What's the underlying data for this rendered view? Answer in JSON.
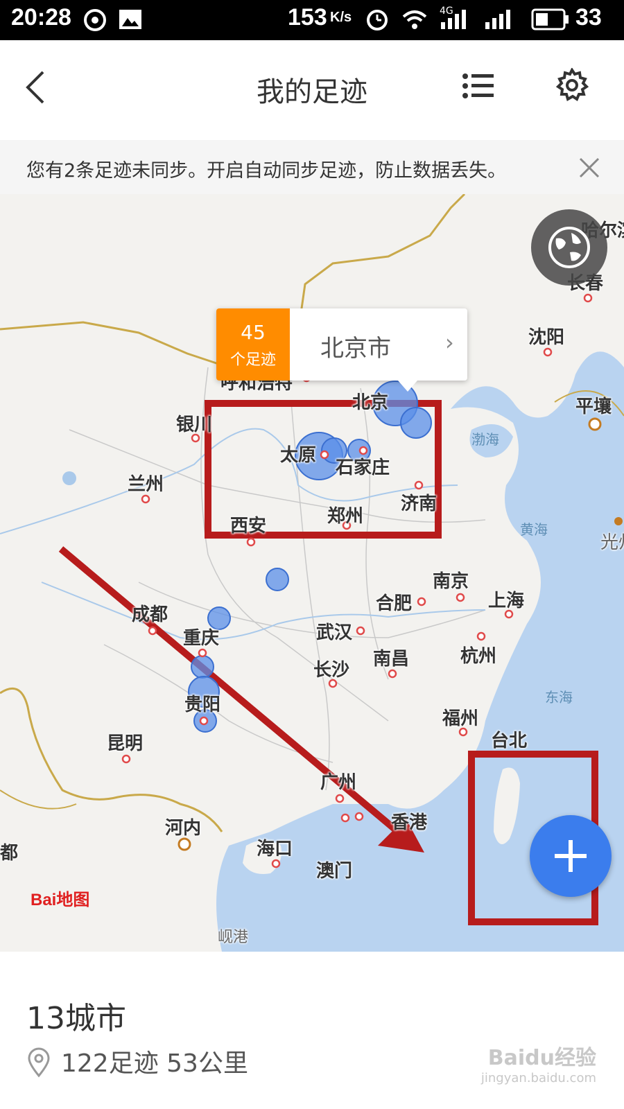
{
  "status_bar": {
    "time": "20:28",
    "network_speed": "153",
    "network_unit": "K/s",
    "signal_label": "4G",
    "battery": "33"
  },
  "header": {
    "back_icon": "chevron-left-icon",
    "title": "我的足迹",
    "list_icon": "list-icon",
    "settings_icon": "gear-icon"
  },
  "notice": {
    "text": "您有2条足迹未同步。开启自动同步足迹，防止数据丢失。",
    "close_icon": "close-icon"
  },
  "map": {
    "popup": {
      "count": "45",
      "count_unit": "个足迹",
      "city": "北京市"
    },
    "cities": [
      "哈尔滨",
      "长春",
      "沈阳",
      "呼和浩特",
      "北京",
      "银川",
      "兰州",
      "太原",
      "石家庄",
      "济南",
      "西安",
      "郑州",
      "平壤",
      "南京",
      "合肥",
      "上海",
      "成都",
      "重庆",
      "武汉",
      "杭州",
      "长沙",
      "南昌",
      "贵阳",
      "昆明",
      "福州",
      "台北",
      "广州",
      "香港",
      "河内",
      "海口",
      "澳门",
      "都",
      "光州",
      "岘港"
    ],
    "seas": [
      "渤海",
      "黄海",
      "东海"
    ],
    "logo": "Bai地图",
    "add_icon": "plus-icon",
    "globe_icon": "globe-icon"
  },
  "summary": {
    "cities": "13城市",
    "stats": "122足迹  53公里",
    "pin_icon": "location-pin-icon"
  },
  "watermark": {
    "line1": "Baidu经验",
    "line2": "jingyan.baidu.com"
  },
  "colors": {
    "accent_blue": "#3b7ded",
    "popup_orange": "#ff8c00",
    "annotation_red": "#b71c1c",
    "sea": "#b9d3f0"
  }
}
